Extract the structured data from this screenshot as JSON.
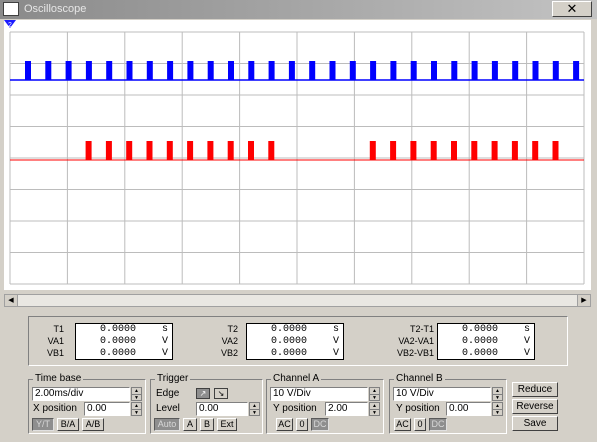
{
  "window": {
    "title": "Oscilloscope",
    "close_glyph": "✕"
  },
  "scope": {
    "background": "#ffffff",
    "grid_color": "#bcbcbc",
    "channel_a_color": "#0000ff",
    "channel_b_color": "#ff0000",
    "cursor_label": "2"
  },
  "scrollbar": {
    "left_arrow": "◀",
    "right_arrow": "▶"
  },
  "readout": {
    "rows": [
      {
        "l1": "T1",
        "v1": "0.0000",
        "u1": "s",
        "l2": "T2",
        "v2": "0.0000",
        "u2": "s",
        "l3": "T2-T1",
        "v3": "0.0000",
        "u3": "s"
      },
      {
        "l1": "VA1",
        "v1": "0.0000",
        "u1": "V",
        "l2": "VA2",
        "v2": "0.0000",
        "u2": "V",
        "l3": "VA2-VA1",
        "v3": "0.0000",
        "u3": "V"
      },
      {
        "l1": "VB1",
        "v1": "0.0000",
        "u1": "V",
        "l2": "VB2",
        "v2": "0.0000",
        "u2": "V",
        "l3": "VB2-VB1",
        "v3": "0.0000",
        "u3": "V"
      }
    ]
  },
  "timebase": {
    "title": "Time base",
    "value": "2.00ms/div",
    "xpos_label": "X position",
    "xpos_value": "0.00",
    "yt": "Y/T",
    "ba": "B/A",
    "ab": "A/B"
  },
  "trigger": {
    "title": "Trigger",
    "edge_label": "Edge",
    "level_label": "Level",
    "level_value": "0.00",
    "auto": "Auto",
    "a": "A",
    "b": "B",
    "ext": "Ext",
    "edge_rise_glyph": "↗",
    "edge_fall_glyph": "↘"
  },
  "channel_a": {
    "title": "Channel A",
    "value": "10  V/Div",
    "ypos_label": "Y position",
    "ypos_value": "2.00",
    "ac": "AC",
    "zero": "0",
    "dc": "DC"
  },
  "channel_b": {
    "title": "Channel B",
    "value": "10  V/Div",
    "ypos_label": "Y position",
    "ypos_value": "0.00",
    "ac": "AC",
    "zero": "0",
    "dc": "DC"
  },
  "actions": {
    "reduce": "Reduce",
    "reverse": "Reverse",
    "save": "Save"
  }
}
